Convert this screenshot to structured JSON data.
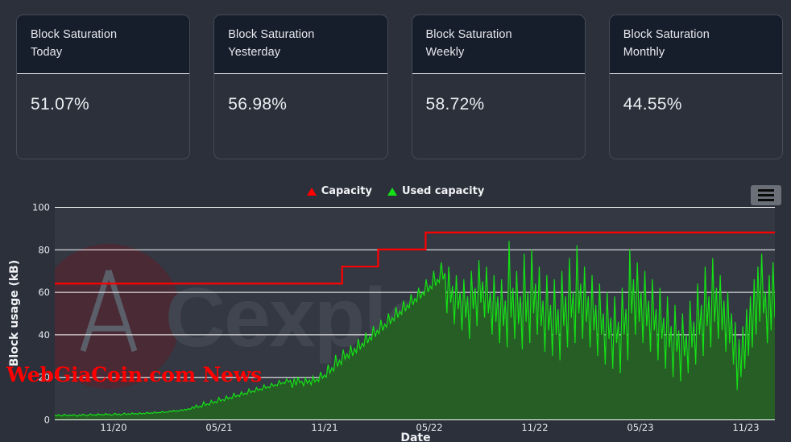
{
  "cards": [
    {
      "title": "Block Saturation\nToday",
      "value": "51.07%"
    },
    {
      "title": "Block Saturation\nYesterday",
      "value": "56.98%"
    },
    {
      "title": "Block Saturation\nWeekly",
      "value": "58.72%"
    },
    {
      "title": "Block Saturation\nMonthly",
      "value": "44.55%"
    }
  ],
  "legend": [
    {
      "label": "Capacity",
      "color": "#ff0000",
      "marker": "triangle-up-icon"
    },
    {
      "label": "Used capacity",
      "color": "#15e015",
      "marker": "triangle-up-icon"
    }
  ],
  "menu": {
    "icon": "hamburger-menu-icon",
    "label": "Chart menu"
  },
  "watermark": {
    "text": "Cexplorer",
    "logo": "cardano-ada-logo"
  },
  "brand": {
    "text": "WebGiaCoin.com News",
    "color": "#ff0000"
  },
  "chart_data": {
    "type": "area",
    "title": "",
    "xlabel": "Date",
    "ylabel": "Block usage (kB)",
    "ylim": [
      0,
      100
    ],
    "yticks": [
      0,
      20,
      40,
      60,
      80,
      100
    ],
    "xticks": [
      "11/20",
      "05/21",
      "11/21",
      "05/22",
      "11/22",
      "05/23",
      "11/23"
    ],
    "grid": true,
    "legend_position": "top-center",
    "series": [
      {
        "name": "Capacity",
        "type": "step",
        "color": "#ff0000",
        "steps": [
          {
            "x_label": "10/20",
            "value": 64
          },
          {
            "x_label": "02/22",
            "value": 72
          },
          {
            "x_label": "04/22",
            "value": 80
          },
          {
            "x_label": "05/22",
            "value": 88
          }
        ]
      },
      {
        "name": "Used capacity",
        "type": "area",
        "color": "#15e015",
        "fill_color": "#265e26",
        "values": [
          2.2,
          1.9,
          2.4,
          2.1,
          1.8,
          2.6,
          2.2,
          1.9,
          2.3,
          2.0,
          2.5,
          2.1,
          1.7,
          2.4,
          2.0,
          2.7,
          2.2,
          1.9,
          2.3,
          2.8,
          2.1,
          2.5,
          2.0,
          2.9,
          2.3,
          2.6,
          2.2,
          3.0,
          2.4,
          2.7,
          2.1,
          2.5,
          3.1,
          2.3,
          2.8,
          2.2,
          2.6,
          3.2,
          2.4,
          2.9,
          2.5,
          3.3,
          2.7,
          3.0,
          2.6,
          3.4,
          2.8,
          3.1,
          2.9,
          3.6,
          3.0,
          3.3,
          3.1,
          3.8,
          3.2,
          3.5,
          3.3,
          4.0,
          3.4,
          3.7,
          3.6,
          4.2,
          3.8,
          4.5,
          4.0,
          4.3,
          4.1,
          4.8,
          4.4,
          5.0,
          4.6,
          5.3,
          4.9,
          6.2,
          5.4,
          7.0,
          5.8,
          6.5,
          6.0,
          8.5,
          6.8,
          7.5,
          7.0,
          9.2,
          7.8,
          8.6,
          8.0,
          10.5,
          8.8,
          9.6,
          9.0,
          11.2,
          9.8,
          10.6,
          10.0,
          12.5,
          10.8,
          11.6,
          11.0,
          13.2,
          11.8,
          12.6,
          12.0,
          14.5,
          12.8,
          13.6,
          13.0,
          15.2,
          13.8,
          14.6,
          14.0,
          16.5,
          14.8,
          15.6,
          15.0,
          17.2,
          15.8,
          16.6,
          16.0,
          18.5,
          16.8,
          17.6,
          17.0,
          19.2,
          17.8,
          18.6,
          15.0,
          19.5,
          16.2,
          20.0,
          17.5,
          18.2,
          16.0,
          19.8,
          17.2,
          18.8,
          16.5,
          20.5,
          17.8,
          19.2,
          18.0,
          22.5,
          19.5,
          21.0,
          20.0,
          26.0,
          22.0,
          24.5,
          23.0,
          30.5,
          25.0,
          28.0,
          26.0,
          33.0,
          28.5,
          31.0,
          29.0,
          35.0,
          30.0,
          33.5,
          31.5,
          38.0,
          33.0,
          36.0,
          34.5,
          41.0,
          36.0,
          39.0,
          37.5,
          44.0,
          39.0,
          42.0,
          40.5,
          47.0,
          42.0,
          45.0,
          43.5,
          50.0,
          45.0,
          48.0,
          46.5,
          53.0,
          48.0,
          51.0,
          49.5,
          56.0,
          51.0,
          54.0,
          52.5,
          59.0,
          54.0,
          57.0,
          55.5,
          62.0,
          57.0,
          60.0,
          58.5,
          66.0,
          60.0,
          63.0,
          61.5,
          70.0,
          63.0,
          66.0,
          64.5,
          74.0,
          66.0,
          69.0,
          50.0,
          72.0,
          55.0,
          63.0,
          45.0,
          68.0,
          52.0,
          60.0,
          42.0,
          66.0,
          48.0,
          58.0,
          38.0,
          70.0,
          52.0,
          62.0,
          44.0,
          75.0,
          55.0,
          65.0,
          48.0,
          72.0,
          50.0,
          60.0,
          40.0,
          68.0,
          46.0,
          58.0,
          36.0,
          66.0,
          44.0,
          56.0,
          34.0,
          84.0,
          48.0,
          62.0,
          38.0,
          70.0,
          45.0,
          58.0,
          33.0,
          78.0,
          46.0,
          60.0,
          36.0,
          80.0,
          50.0,
          64.0,
          40.0,
          72.0,
          44.0,
          56.0,
          32.0,
          68.0,
          42.0,
          54.0,
          30.0,
          66.0,
          40.0,
          52.0,
          28.0,
          70.0,
          44.0,
          58.0,
          34.0,
          76.0,
          48.0,
          60.0,
          36.0,
          82.0,
          50.0,
          64.0,
          38.0,
          72.0,
          46.0,
          58.0,
          34.0,
          68.0,
          42.0,
          54.0,
          30.0,
          64.0,
          40.0,
          50.0,
          26.0,
          60.0,
          38.0,
          48.0,
          24.0,
          58.0,
          36.0,
          46.0,
          22.0,
          62.0,
          40.0,
          52.0,
          28.0,
          80.0,
          50.0,
          66.0,
          40.0,
          74.0,
          46.0,
          60.0,
          36.0,
          70.0,
          44.0,
          56.0,
          32.0,
          66.0,
          42.0,
          52.0,
          28.0,
          62.0,
          38.0,
          48.0,
          24.0,
          58.0,
          34.0,
          44.0,
          20.0,
          54.0,
          32.0,
          42.0,
          18.0,
          50.0,
          30.0,
          40.0,
          22.0,
          56.0,
          34.0,
          46.0,
          26.0,
          64.0,
          40.0,
          54.0,
          30.0,
          72.0,
          44.0,
          58.0,
          34.0,
          76.0,
          46.0,
          62.0,
          38.0,
          68.0,
          42.0,
          56.0,
          32.0,
          60.0,
          36.0,
          50.0,
          26.0,
          46.0,
          14.0,
          38.0,
          20.0,
          44.0,
          24.0,
          52.0,
          30.0,
          58.0,
          34.0,
          66.0,
          40.0,
          72.0,
          46.0,
          78.0,
          50.0,
          60.0,
          36.0,
          68.0,
          42.0,
          74.0,
          48.0
        ]
      }
    ]
  }
}
